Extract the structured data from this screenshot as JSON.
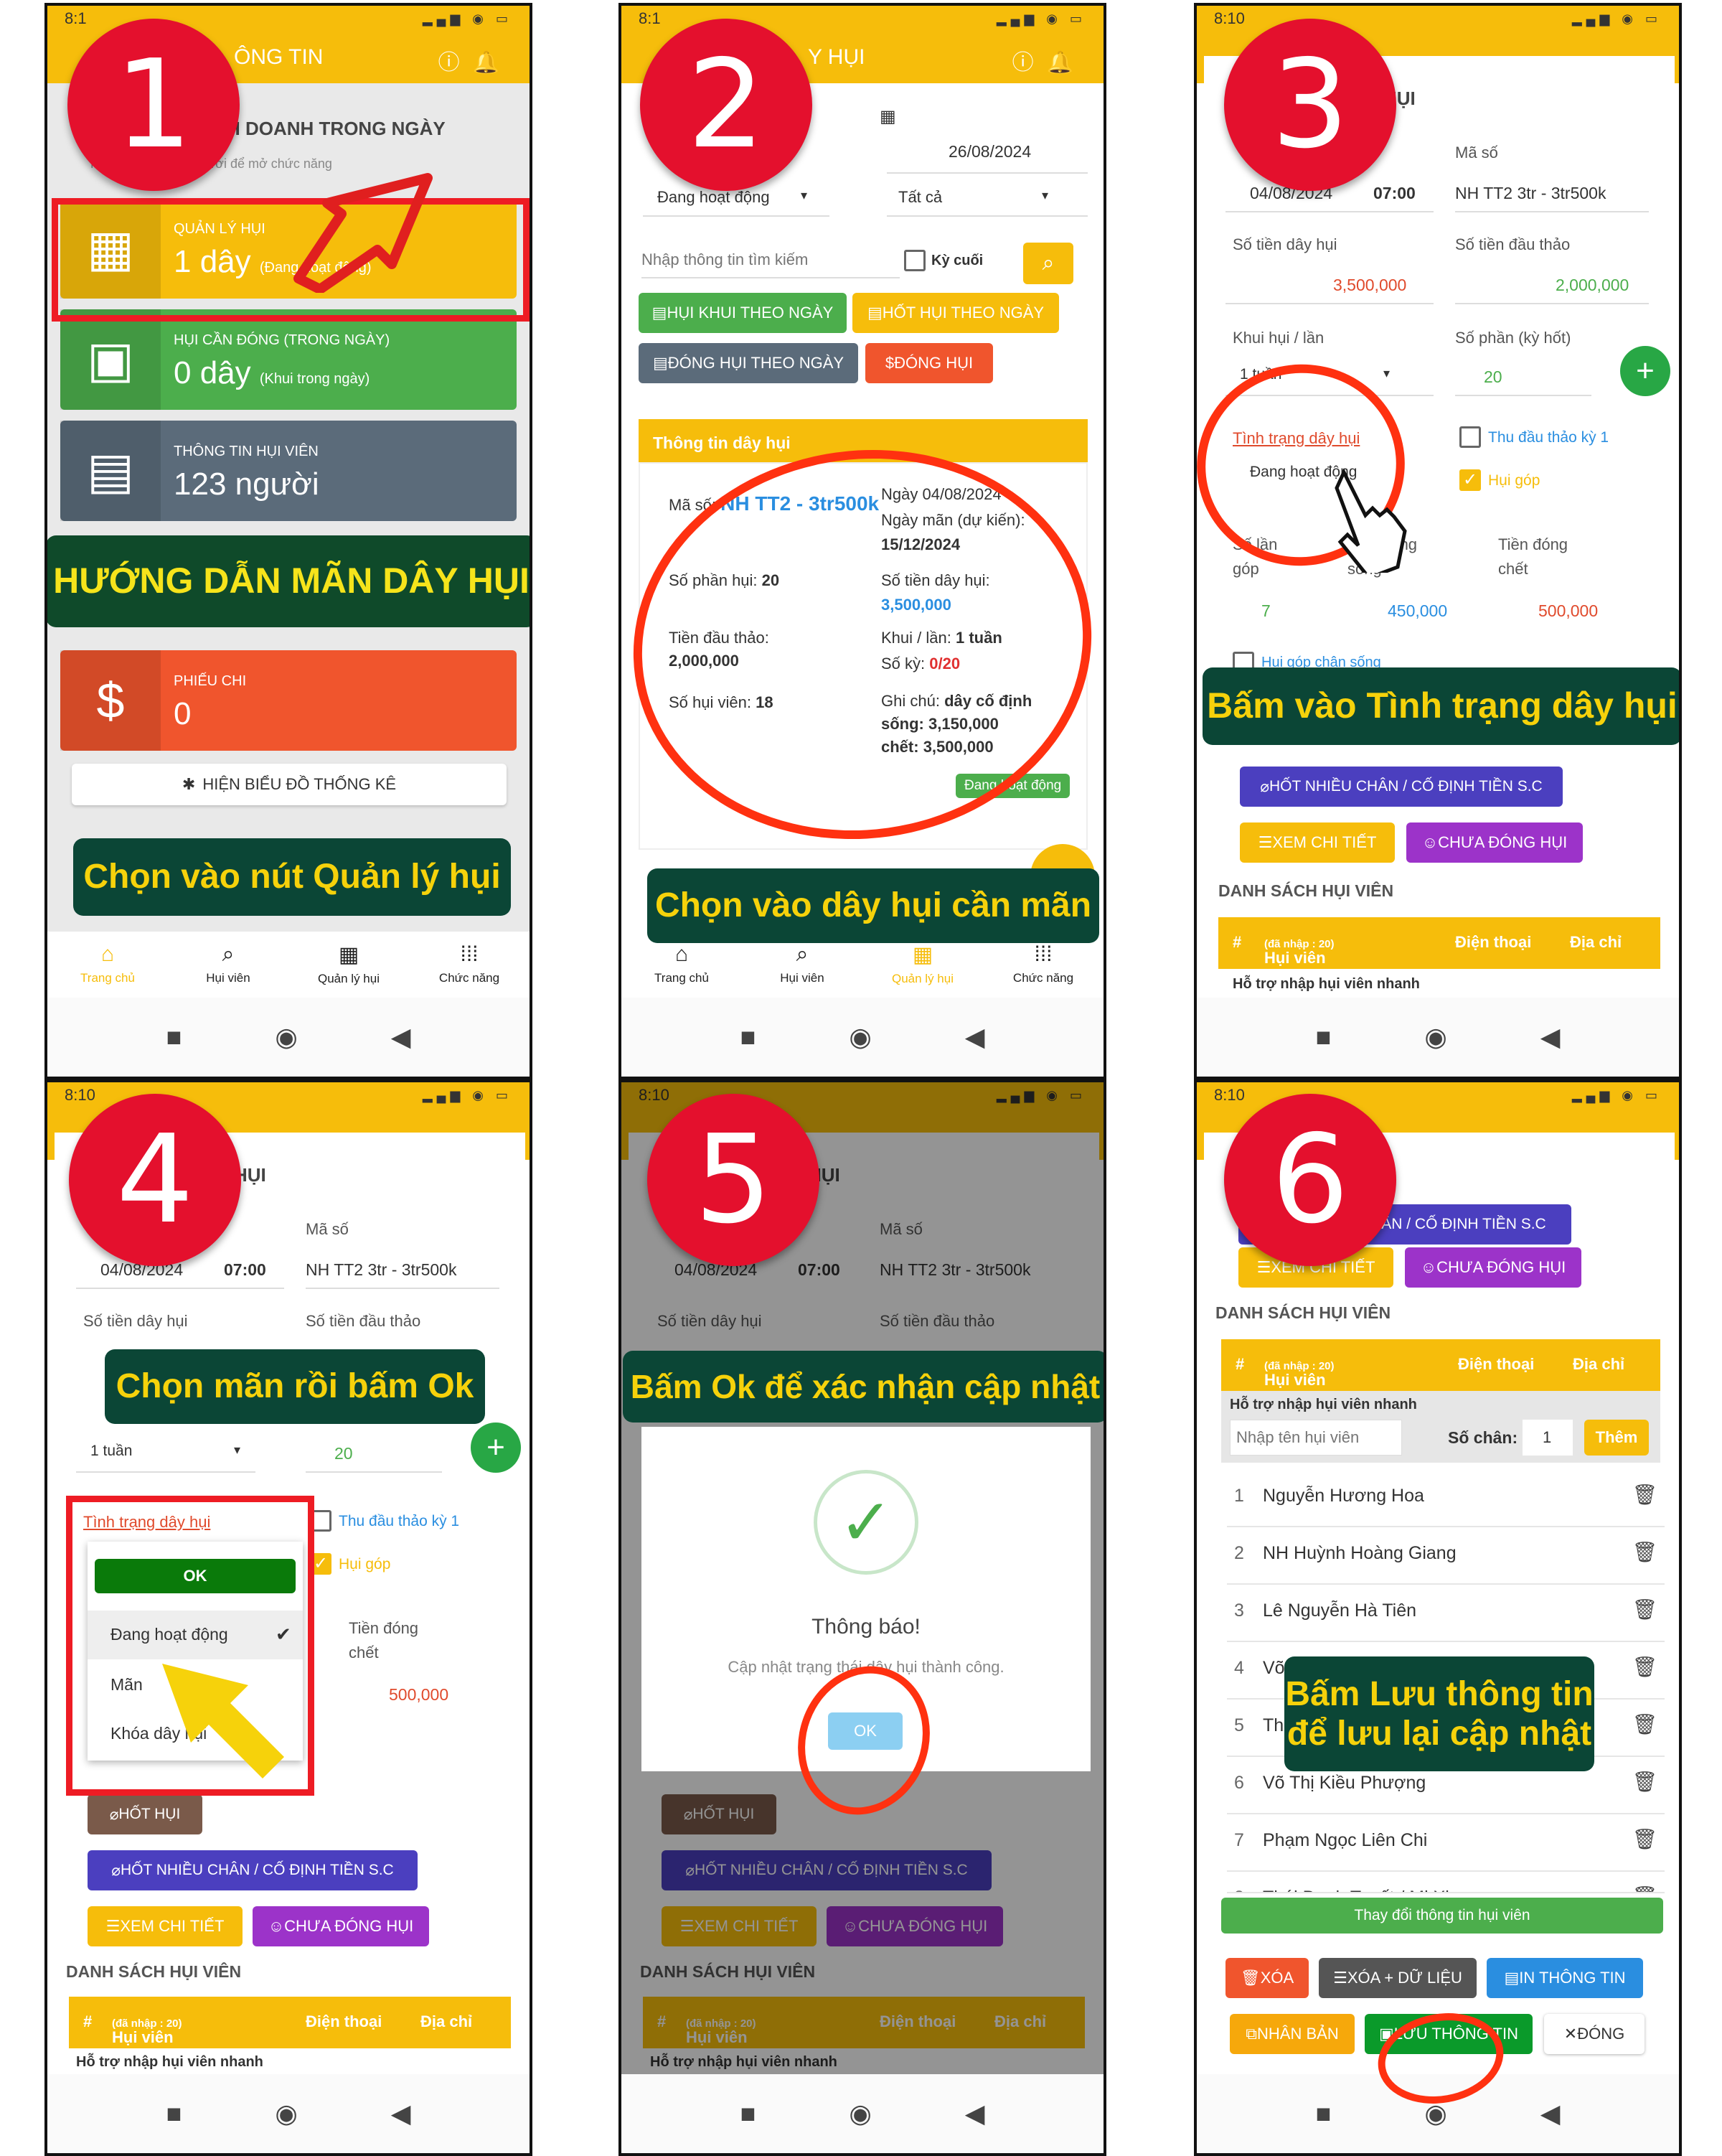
{
  "status_time": "8:10",
  "status_time_short": "8:1",
  "battery": "34",
  "steps": [
    "1",
    "2",
    "3",
    "4",
    "5",
    "6"
  ],
  "captions": {
    "s1": "Chọn vào nút Quản lý hụi",
    "s2": "Chọn vào dây hụi cần mãn",
    "s3": "Bấm vào Tình trạng dây hụi",
    "s4": "Chọn mãn rồi bấm Ok",
    "s5": "Bấm Ok để xác nhận cập nhật",
    "s6_l1": "Bấm Lưu thông tin",
    "s6_l2": "để lưu lại cập nhật"
  },
  "nav": [
    {
      "label": "Trang chủ",
      "icon": "home-icon"
    },
    {
      "label": "Hụi viên",
      "icon": "member-search-icon"
    },
    {
      "label": "Quản lý hụi",
      "icon": "building-icon"
    },
    {
      "label": "Chức năng",
      "icon": "grid-icon"
    }
  ],
  "screen1": {
    "appbar_title": "ÔNG TIN",
    "section_title": "H DOANH TRONG NGÀY",
    "section_hint": "Nhấn vào nút phía dưới để mở chức năng",
    "tiles": [
      {
        "title": "QUẢN LÝ HỤI",
        "value": "1 dây",
        "sub": "(Đang hoạt động)",
        "color": "#f6bd0b"
      },
      {
        "title": "HỤI CẦN ĐÓNG (TRONG NGÀY)",
        "value": "0 dây",
        "sub": "(Khui trong ngày)",
        "color": "#4cae4c"
      },
      {
        "title": "THÔNG TIN HỤI VIÊN",
        "value": "123 người",
        "sub": "",
        "color": "#5b6b7a"
      },
      {
        "title": "PHIẾU CHI",
        "value": "0",
        "sub": "",
        "color": "#f0552d"
      }
    ],
    "overlay_banner": "HƯỚNG DẪN MÃN DÂY HỤI",
    "chart_button": "HIỆN BIỂU ĐỒ THỐNG KÊ"
  },
  "screen2": {
    "appbar_title": "Y HỤI",
    "date_to": "26/08/2024",
    "status_filter": "Đang hoạt động",
    "type_filter": "Tất cả",
    "search_placeholder": "Nhập thông tin tìm kiếm",
    "last_period_label": "Kỳ cuối",
    "btn_khui": "HỤI KHUI THEO NGÀY",
    "btn_hot": "HỐT HỤI THEO NGÀY",
    "btn_dong_ngay": "ĐÓNG HỤI THEO NGÀY",
    "btn_dong": "ĐÓNG HỤI",
    "card_title": "Thông tin dây hụi",
    "ma_so_label": "Mã số:",
    "ma_so_value": "NH TT2 - 3tr500k",
    "so_phan_label": "Số phần hụi:",
    "so_phan_value": "20",
    "dau_thao_label": "Tiền đầu thảo:",
    "dau_thao_value": "2,000,000",
    "so_hui_vien_label": "Số hụi viên:",
    "so_hui_vien_value": "18",
    "ngay_label": "Ngày",
    "ngay_value": "04/08/2024",
    "ngay_man_label": "Ngày mãn (dự kiến):",
    "ngay_man_value": "15/12/2024",
    "so_tien_label": "Số tiền dây hụi:",
    "so_tien_value": "3,500,000",
    "khui_label": "Khui / lần:",
    "khui_value": "1 tuần",
    "so_ky_label": "Số kỳ:",
    "so_ky_value": "0/20",
    "ghi_chu_label": "Ghi chú:",
    "ghi_chu_value": "dây cố định",
    "song_label": "sống:",
    "song_value": "3,150,000",
    "chet_label": "chết:",
    "chet_value": "3,500,000",
    "status_badge": "Đang hoạt động"
  },
  "detail": {
    "appbar_title": "HỤI",
    "date": "04/08/2024",
    "time": "07:00",
    "ma_so_label": "Mã số",
    "ma_so": "NH TT2 3tr - 3tr500k",
    "so_tien_label": "Số tiền dây hụi",
    "so_tien": "3,500,000",
    "dau_thao_label": "Số tiền đầu thảo",
    "dau_thao": "2,000,000",
    "khui_label": "Khui hụi / lần",
    "khui": "1 tuần",
    "so_phan_label": "Số phần (kỳ hốt)",
    "so_phan": "20",
    "tinh_trang_label": "Tình trạng dây hụi",
    "tinh_trang": "Đang hoạt động",
    "thu_dau_thao": "Thu đầu thảo kỳ 1",
    "hui_gop": "Hụi góp",
    "so_lan_label": "Số lần góp",
    "so_lan": "7",
    "tien_song_label": "Tiền đóng sống",
    "tien_song": "450,000",
    "tien_chet_label": "Tiền đóng chết",
    "tien_chet": "500,000",
    "hui_gop_chan": "Hụi góp chân sống",
    "btn_hot": "HỐT HỤI",
    "btn_hot_nhieu": "HỐT NHIỀU CHÂN / CỐ ĐỊNH TIỀN S.C",
    "btn_xem": "XEM CHI TIẾT",
    "btn_chua_dong": "CHƯA ĐÓNG HỤI",
    "ds_title": "DANH SÁCH HỤI VIÊN",
    "col_hash": "#",
    "col_hui_vien": "Hụi viên",
    "col_da_nhap": "(đã nhập : 20)",
    "col_dien_thoai": "Điện thoại",
    "col_dia_chi": "Địa chỉ",
    "ho_tro": "Hỗ trợ nhập hụi viên nhanh",
    "nhap_placeholder": "Nhập tên hụi viên",
    "so_chan_label": "Số chân:",
    "so_chan": "1",
    "them": "Thêm"
  },
  "picker": {
    "ok": "OK",
    "options": [
      "Đang hoạt động",
      "Mãn",
      "Khóa dây hụi"
    ]
  },
  "dialog": {
    "title": "Thông báo!",
    "message": "Cập nhật trạng thái dây hụi thành công.",
    "ok": "OK"
  },
  "screen6": {
    "members": [
      {
        "n": "1",
        "name": "Nguyễn Hương Hoa"
      },
      {
        "n": "2",
        "name": "NH Huỳnh Hoàng Giang"
      },
      {
        "n": "3",
        "name": "Lê Nguyễn Hà Tiên"
      },
      {
        "n": "4",
        "name": "Võ"
      },
      {
        "n": "5",
        "name": "Thị"
      },
      {
        "n": "6",
        "name": "Võ Thị Kiều Phượng"
      },
      {
        "n": "7",
        "name": "Phạm Ngọc Liên Chi"
      },
      {
        "n": "8",
        "name": "Thái Danh Tuyết / Mi Xi"
      }
    ],
    "btn_change": "Thay đổi thông tin hụi viên",
    "btn_xoa": "XÓA",
    "btn_xoa_du": "XÓA + DỮ LIỆU",
    "btn_in": "IN THÔNG TIN",
    "btn_nhan_ban": "NHÂN BẢN",
    "btn_luu": "LƯU THÔNG TIN",
    "btn_dong": "ĐÓNG"
  }
}
